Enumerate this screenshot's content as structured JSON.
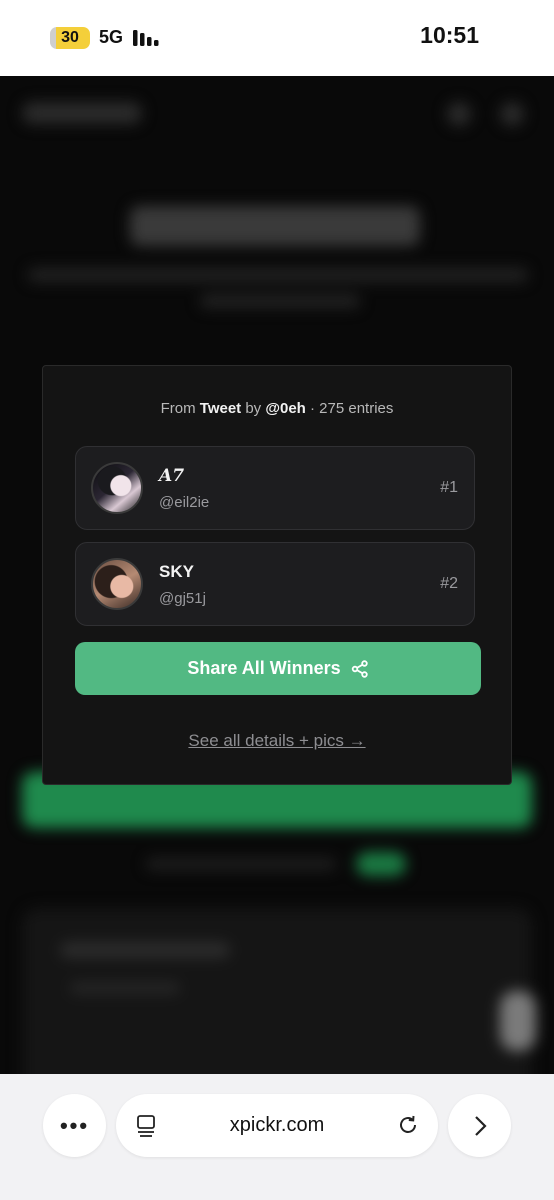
{
  "status_bar": {
    "battery": "30",
    "network": "5G",
    "time": "10:51"
  },
  "modal": {
    "source": {
      "prefix": "From",
      "type": "Tweet",
      "by": "by",
      "author": "@0eh",
      "entries": "· 275 entries"
    },
    "winners": [
      {
        "name": "A7",
        "handle": "@eil2ie",
        "rank": "#1"
      },
      {
        "name": "SKY",
        "handle": "@gj51j",
        "rank": "#2"
      }
    ],
    "share_label": "Share All Winners",
    "details_link": "See all details + pics →"
  },
  "browser": {
    "more": "•••",
    "url": "xpickr.com"
  },
  "colors": {
    "accent": "#52b983",
    "modal_bg": "#141414",
    "card_bg": "#1d1d1f"
  }
}
